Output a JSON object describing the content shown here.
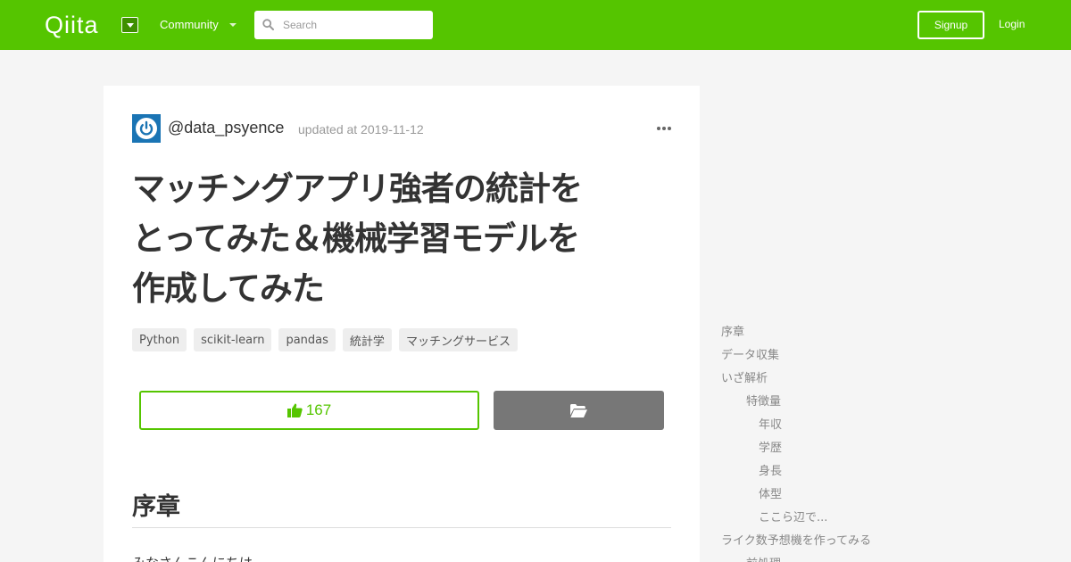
{
  "header": {
    "logo_text": "Qiita",
    "community_label": "Community",
    "search_placeholder": "Search",
    "signup_label": "Signup",
    "login_label": "Login",
    "brand_color": "#55c500"
  },
  "article": {
    "author": "@data_psyence",
    "updated": "updated at 2019-11-12",
    "title_lines": [
      "マッチングアプリ強者の統計を",
      "とってみた＆機械学習モデルを",
      "作成してみた"
    ],
    "tags": [
      "Python",
      "scikit-learn",
      "pandas",
      "統計学",
      "マッチングサービス"
    ],
    "like_count": "167",
    "section_heading": "序章",
    "body_first_line": "みなさんこんにちは"
  },
  "toc": {
    "items": [
      {
        "label": "序章",
        "level": 1
      },
      {
        "label": "データ収集",
        "level": 1
      },
      {
        "label": "いざ解析",
        "level": 1
      },
      {
        "label": "特徴量",
        "level": 2
      },
      {
        "label": "年収",
        "level": 3
      },
      {
        "label": "学歴",
        "level": 3
      },
      {
        "label": "身長",
        "level": 3
      },
      {
        "label": "体型",
        "level": 3
      },
      {
        "label": "ここら辺で...",
        "level": 3
      },
      {
        "label": "ライク数予想機を作ってみる",
        "level": 1
      },
      {
        "label": "前処理",
        "level": 2
      }
    ]
  }
}
